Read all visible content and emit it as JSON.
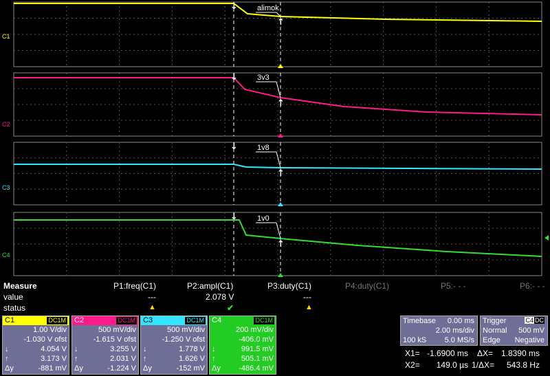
{
  "channels": [
    {
      "id": "C1",
      "color": "#ffff00",
      "label": "alimok",
      "scale": "1.00 V/div",
      "offset": "-1.030 V ofst",
      "cursor1": "4.054 V",
      "cursor2": "3.173 V",
      "delta": "-881 mV",
      "coupling": "DC1M"
    },
    {
      "id": "C2",
      "color": "#ff1a8c",
      "label": "3v3",
      "scale": "500 mV/div",
      "offset": "-1.615 V ofst",
      "cursor1": "3.255 V",
      "cursor2": "2.031 V",
      "delta": "-1.224 V",
      "coupling": "DC1M"
    },
    {
      "id": "C3",
      "color": "#33e6ff",
      "label": "1v8",
      "scale": "500 mV/div",
      "offset": "-1.250 V ofst",
      "cursor1": "1.778 V",
      "cursor2": "1.626 V",
      "delta": "-152 mV",
      "coupling": "DC1M"
    },
    {
      "id": "C4",
      "color": "#33dd33",
      "label": "1v0",
      "scale": "200 mV/div",
      "offset": "-406.0 mV",
      "cursor1": "991.5 mV",
      "cursor2": "505.1 mV",
      "delta": "-486.4 mV",
      "coupling": "DC1M"
    }
  ],
  "measure": {
    "title": "Measure",
    "row_value": "value",
    "row_status": "status",
    "params": [
      {
        "name": "P1:freq(C1)",
        "value": "---",
        "status": "warn",
        "dim": false
      },
      {
        "name": "P2:ampl(C1)",
        "value": "2.078 V",
        "status": "ok",
        "dim": false
      },
      {
        "name": "P3:duty(C1)",
        "value": "---",
        "status": "warn",
        "dim": false
      },
      {
        "name": "P4:duty(C1)",
        "value": "",
        "status": "",
        "dim": true
      },
      {
        "name": "P5:- - -",
        "value": "",
        "status": "",
        "dim": true
      },
      {
        "name": "P6:- - -",
        "value": "",
        "status": "",
        "dim": true
      }
    ]
  },
  "cursor_glyphs": {
    "down": "↓",
    "up": "↑",
    "delta": "Δy"
  },
  "timebase": {
    "title": "Timebase",
    "delay": "0.00 ms",
    "per_div": "2.00 ms/div",
    "samples": "100 kS",
    "rate": "5.0 MS/s"
  },
  "trigger": {
    "title": "Trigger",
    "source": "C4",
    "coupling": "DC",
    "mode": "Normal",
    "level": "500 mV",
    "type": "Edge",
    "slope": "Negative"
  },
  "cursors": {
    "x1_label": "X1=",
    "x1": "-1.6900 ms",
    "dx_label": "ΔX=",
    "dx": "1.8390 ms",
    "x2_label": "X2=",
    "x2": "149.0 µs",
    "inv_label": "1/ΔX=",
    "inv": "543.8 Hz"
  },
  "colors": {
    "warn": "#ffd700",
    "ok": "#33dd33",
    "panel": "#6e6e96"
  }
}
